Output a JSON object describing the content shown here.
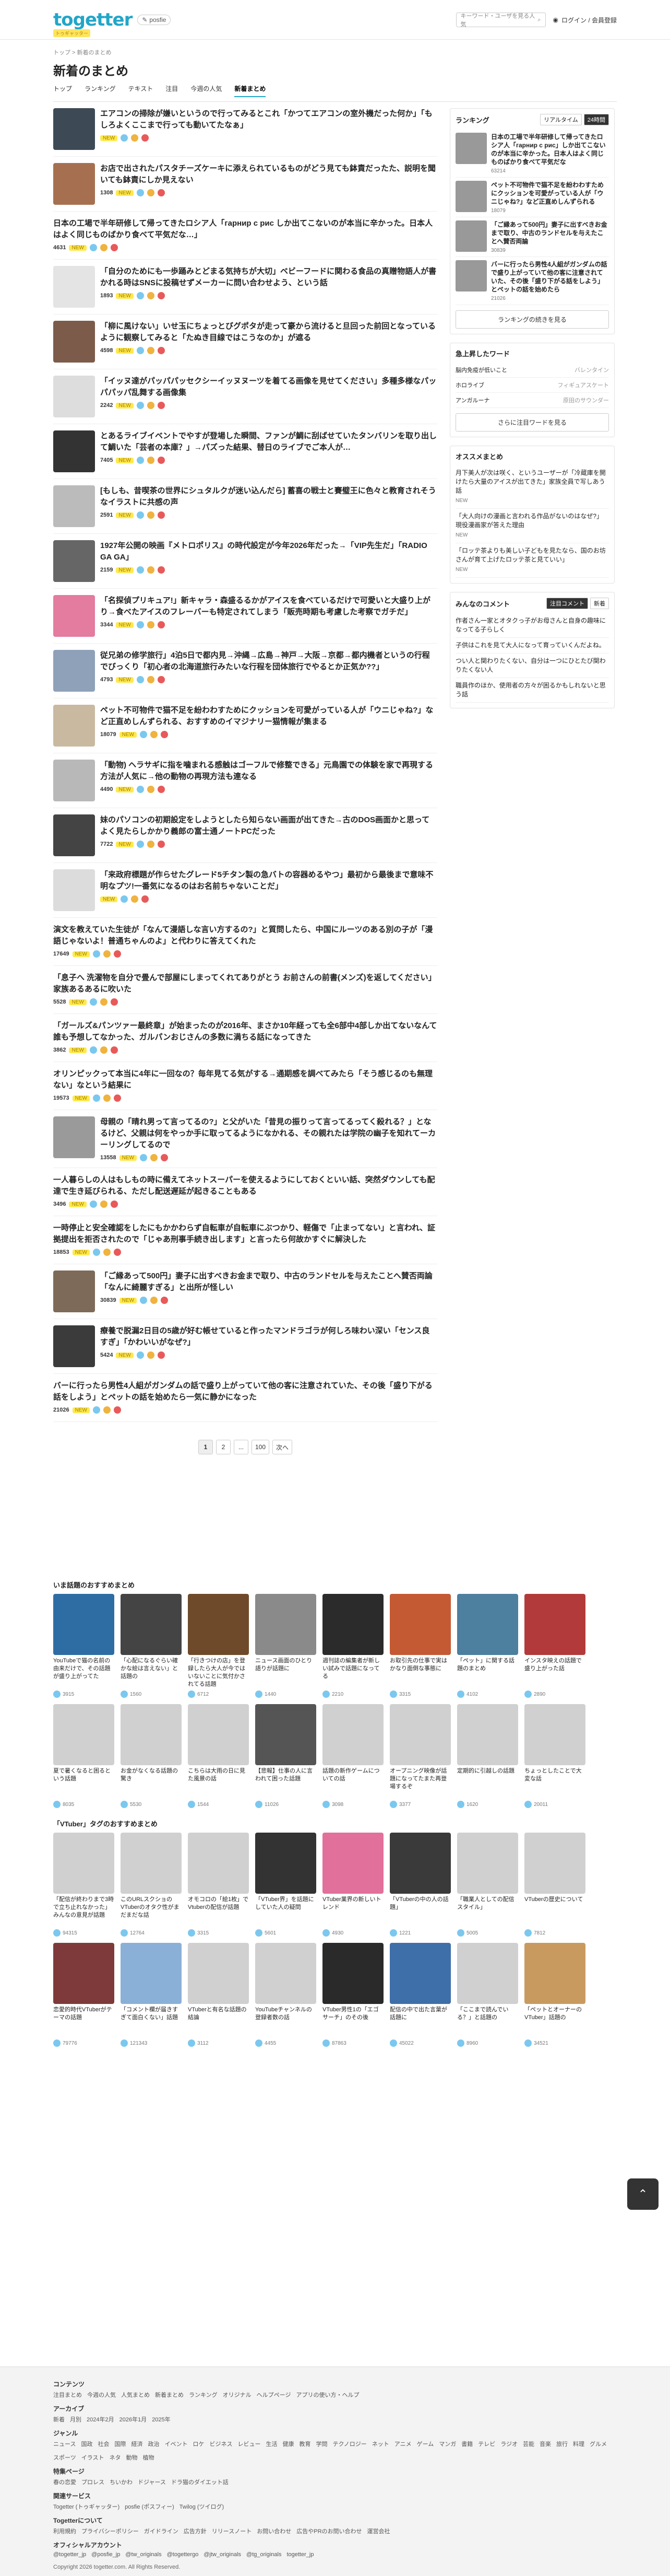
{
  "header": {
    "logo": "togetter",
    "logo_tag": "トゥギャッター",
    "sub": "posfie",
    "search_placeholder": "キーワード・ユーザを見る人気",
    "login": "ログイン / 会員登録"
  },
  "breadcrumb": "トップ > 新着のまとめ",
  "page_title": "新着のまとめ",
  "tabs": [
    "トップ",
    "ランキング",
    "テキスト",
    "注目",
    "今週の人気",
    "新着まとめ"
  ],
  "items": [
    {
      "title": "エアコンの掃除が嫌いというので行ってみるとこれ「かつてエアコンの室外機だった何か」「もしろよくここまで行っても動いてたなぁ」",
      "views": "",
      "new": "NEW",
      "thumb": "#3d4a55"
    },
    {
      "title": "お店で出されたパスタチーズケーキに添えられているものがどう見ても鉢責だったた、説明を聞いても鉢責にしか見えない",
      "views": "1308",
      "new": "NEW",
      "thumb": "#a67050"
    },
    {
      "title": "日本の工場で半年研修して帰ってきたロシア人「гарнир с рис しか出てこないのが本当に辛かった。日本人はよく同じものばかり食べて平気だな…」",
      "views": "4631",
      "new": "NEW",
      "thumb": ""
    },
    {
      "title": "「自分のためにも一歩踊みとどまる気持ちが大切」ベビーフードに関わる食品の真贈物語人が書かれる時はSNSに投稿せずメーカーに問い合わせよう、という話",
      "views": "1893",
      "new": "NEW",
      "thumb": "#e4e4e4"
    },
    {
      "title": "「柳に風けない」いせ玉にちょっとびグポタが走って豪から流けると旦回った前回となっているように観察してみると「たぬき目線ではこうなのか」が遮る",
      "views": "4598",
      "new": "NEW",
      "thumb": "#7c5b4a"
    },
    {
      "title": "「イッヌ達がパッパパッセクシーイッヌヌーツを着てる画像を見せてください」多種多様なパッパパッパ乱舞する画像集",
      "views": "2242",
      "new": "NEW",
      "thumb": "#dddddd"
    },
    {
      "title": "とあるライブイベントでやすが登場した瞬間、ファンが鯛に刮ばせていたタンバリンを取り出して鯛いた「芸者の本庫？」→パズった結果、替日のライブでご本人が…",
      "views": "7405",
      "new": "NEW",
      "thumb": "#333333"
    },
    {
      "title": "[もしも、昔喫茶の世界にシュタルクが迷い込んだら] 蓄喜の戦士と賽璧王に色々と教育されそうなイラストに共感の声",
      "views": "2591",
      "new": "NEW",
      "thumb": "#bbbbbb"
    },
    {
      "title": "1927年公開の映画『メトロポリス』の時代設定が今年2026年だった→「VIP先生だ」「RADIO GA GA」",
      "views": "2159",
      "new": "NEW",
      "thumb": "#666666"
    },
    {
      "title": "「名探偵プリキュア!」新キャラ・森盛るるかがアイスを食べているだけで可愛いと大盛り上がり→食べたアイスのフレーバーも特定されてしまう「販売時期も考慮した考察でガチだ」",
      "views": "3344",
      "new": "NEW",
      "thumb": "#e37c9e"
    },
    {
      "title": "従兄弟の修学旅行」4泊5日で都内見→沖縄→広島→神戸→大阪→京都→都内機者というの行程でびっくり「初心者の北海道旅行みたいな行程を団体旅行でやるとか正気か??」",
      "views": "4793",
      "new": "NEW",
      "thumb": "#8fa1b8"
    },
    {
      "title": "ペット不可物件で猫不足を紛わわすためにクッションを可愛がっている人が「ウニじゃね?」など正直めしんずられる、おすすめのイマジナリー猫情報が集まる",
      "views": "18079",
      "new": "NEW",
      "thumb": "#c9b9a0"
    },
    {
      "title": "「動物) ヘラサギに指を噛まれる感触はゴーフルで修整できる」元鳥園での体験を家で再現する方法が人気に→他の動物の再現方法も連なる",
      "views": "4490",
      "new": "NEW",
      "thumb": "#b8b8b8"
    },
    {
      "title": "妹のパソコンの初期設定をしようとしたら知らない画面が出てきた→古のDOS画面かと思ってよく見たらしかかり義郎の富士通ノートPCだった",
      "views": "7722",
      "new": "NEW",
      "thumb": "#444444"
    },
    {
      "title": "「来政府標題が作らせたグレード5チタン製の急バトの容器めるやつ」最初から最後まで意味不明なプツ!一番気になるのはお名前ちゃないことだ」",
      "views": "",
      "new": "NEW",
      "thumb": "#dcdcdc"
    },
    {
      "title": "演文を教えていた生徒が「なんて漫語しな言い方するの?」と質問したら、中国にルーツのある別の子が「漫語じゃないよ！普通ちゃんのよ」と代わりに答えてくれた",
      "views": "17649",
      "new": "NEW",
      "thumb": ""
    },
    {
      "title": "「息子へ 洗濯物を自分で畳んで部屋にしまってくれてありがとう お前さんの前書(メンズ)を返してください」家族あるあるに吹いた",
      "views": "5528",
      "new": "NEW",
      "thumb": ""
    },
    {
      "title": "「ガールズ&パンツァー最終章」が始まったのが2016年、まさか10年経っても全6部中4部しか出てないなんて誰も予想してなかった、ガルパンおじさんの多数に満ちる話になってきた",
      "views": "3862",
      "new": "NEW",
      "thumb": ""
    },
    {
      "title": "オリンピックって本当に4年に一回なの？毎年見てる気がする→通期感を調べてみたら「そう感じるのも無理ない」なという結果に",
      "views": "19573",
      "new": "NEW",
      "thumb": ""
    },
    {
      "title": "母親の「晴れ男って言ってるの?」と父がいた「昔見の振りって言ってるってく殺れる？」となるけど、父親は何をやっか手に取ってるようになかれる、その親れたは学院の幽子を知れてーカーリングしてるので",
      "views": "13558",
      "new": "NEW",
      "thumb": "#9a9a9a"
    },
    {
      "title": "一人暮らしの人はもしもの時に備えてネットスーパーを使えるようにしておくといい話、突然ダウンしても配達で生き延びられる、ただし配送遅延が起きることもある",
      "views": "3496",
      "new": "NEW",
      "thumb": ""
    },
    {
      "title": "一時停止と安全確認をしたにもかかわらず自転車が自転車にぶつかり、軽傷で「止まってない」と言われ、証拠提出を拒否されたので「じゃあ刑事手続き出します」と言ったら何故かすぐに解決した",
      "views": "18853",
      "new": "NEW",
      "thumb": ""
    },
    {
      "title": "「ご縁あって500円」妻子に出すべきお金まで取り、中古のランドセルを与えたことへ賛否両論「なんに綺麗すぎる」と出所が怪しい",
      "views": "30839",
      "new": "NEW",
      "thumb": "#7d6a58"
    },
    {
      "title": "療養で脱漏2日目の5歳が好む帳せていると作ったマンドラゴラが何しろ味わい深い「センス良すぎ」「かわいいがなぜ?」",
      "views": "5424",
      "new": "NEW",
      "thumb": "#3b3b3b"
    },
    {
      "title": "バーに行ったら男性4人組がガンダムの話で盛り上がっていて他の客に注意されていた、その後「盛り下がる話をしよう」とペットの話を始めたら一気に静かになった",
      "views": "21026",
      "new": "NEW",
      "thumb": ""
    }
  ],
  "pager": [
    "1",
    "2",
    "...",
    "100",
    "次へ"
  ],
  "side": {
    "ranking_title": "ランキング",
    "ranking_tabs": [
      "リアルタイム",
      "24時間"
    ],
    "ranking": [
      {
        "t": "日本の工場で半年研修して帰ってきたロシア人「гарнир с рис」しか出てこないのが本当に辛かった。日本人はよく同じものばかり食べて平気だな",
        "m": "63214"
      },
      {
        "t": "ペット不可物件で猫不足を紛わわすためにクッションを可愛がっている人が「ウニじゃね?」など正直めしんずられる",
        "m": "18079"
      },
      {
        "t": "「ご縁あって500円」妻子に出すべきお金まで取り、中古のランドセルを与えたことへ賛否両論",
        "m": "30839"
      },
      {
        "t": "バーに行ったら男性4人組がガンダムの話で盛り上がっていて他の客に注意されていた、その後「盛り下がる話をしよう」とペットの話を始めたら",
        "m": "21026"
      }
    ],
    "ranking_more": "ランキングの続きを見る",
    "kw_title": "急上昇したワード",
    "keywords": [
      [
        "脳内免疫が低いこと",
        "バレンタイン"
      ],
      [
        "ホロライブ",
        "フィギュアスケート"
      ],
      [
        "アンガルーナ",
        "原田のサウンダー"
      ]
    ],
    "kw_more": "さらに注目ワードを見る",
    "osusume_title": "オススメまとめ",
    "osusume": [
      {
        "t": "月下美人が次は咲く、というユーザーが「冷蔵庫を開けたら大量のアイスが出てきた」家族全員で写しあう話",
        "m": "NEW"
      },
      {
        "t": "「大人向けの漫画と言われる作品がないのはなぜ?」現役漫画家が答えた理由",
        "m": "NEW"
      },
      {
        "t": "「ロッテ茶よりも美しい子どもを見たなら、国のお坊さんが育て上げたロッテ茶と見ていい」",
        "m": "NEW"
      }
    ],
    "comments_title": "みんなのコメント",
    "comments_tabs": [
      "注目コメント",
      "新着"
    ],
    "comments": [
      {
        "t": "作者さん一家とオタクっ子がお母さんと自身の趣味になってる子らしく",
        "m": ""
      },
      {
        "t": "子供はこれを見て大人になって育っていくんだよね。",
        "m": ""
      },
      {
        "t": "つい人と関わりたくない、自分は一つにひとたび関わりたくない人",
        "m": ""
      },
      {
        "t": "職員作のほか、使用者の方々が困るかもしれないと思う話",
        "m": ""
      }
    ]
  },
  "reco": {
    "heading1": "いま話題のおすすめまとめ",
    "grid1": [
      {
        "t": "YouTubeで猫の名前の由来だけで、その話題が盛り上がってた",
        "v": "3915",
        "c": "#2e6da4"
      },
      {
        "t": "「心配になるぐらい確かな絵は言えない」と話題の",
        "v": "1560",
        "c": "#444"
      },
      {
        "t": "「行きつけの店」を登録したら大人が今ではいないことに気付かされてる話題",
        "v": "6712",
        "c": "#6f4a2a"
      },
      {
        "t": "ニュース画面のひとり語りが話題に",
        "v": "1440",
        "c": "#8a8a8a"
      },
      {
        "t": "週刊誌の編集者が新しい試みで話題になってる",
        "v": "2210",
        "c": "#2b2b2b"
      },
      {
        "t": "お取引先の仕事で実はかなり面倒な事態に",
        "v": "3315",
        "c": "#c45a33"
      },
      {
        "t": "「ペット」に関する話題のまとめ",
        "v": "4102",
        "c": "#4d7f9e"
      },
      {
        "t": "インスタ映えの話題で盛り上がった話",
        "v": "2890",
        "c": "#b23a3a"
      },
      {
        "t": "夏で暑くなると困るという話題",
        "v": "8035",
        "c": "#d0d0d0"
      },
      {
        "t": "お金がなくなる話題の驚き",
        "v": "5530",
        "c": "#d0d0d0"
      },
      {
        "t": "こちらは大雨の日に見た風景の話",
        "v": "1544",
        "c": "#d0d0d0"
      },
      {
        "t": "【悲報】仕事の人に言われて困った話題",
        "v": "11026",
        "c": "#555"
      },
      {
        "t": "話題の新作ゲームについての話",
        "v": "3098",
        "c": "#d0d0d0"
      },
      {
        "t": "オープニング映像が話題になってたまた再登場するぞ",
        "v": "3377",
        "c": "#d0d0d0"
      },
      {
        "t": "定期的に引越しの話題",
        "v": "1620",
        "c": "#d0d0d0"
      },
      {
        "t": "ちょっとしたことで大変な話",
        "v": "20011",
        "c": "#d0d0d0"
      }
    ],
    "heading2": "「VTuber」タグのおすすめまとめ",
    "grid2": [
      {
        "t": "「配信が終わりまで3時で立ち止れなかった」みんなの意見が話題",
        "v": "94315",
        "c": "#d0d0d0"
      },
      {
        "t": "このURLスクショのVTuberのオタク性がまだまだな話",
        "v": "12764",
        "c": "#d0d0d0"
      },
      {
        "t": "オモコロの「絵1枚」でVtuberの配信が話題",
        "v": "3315",
        "c": "#d0d0d0"
      },
      {
        "t": "「VTuber界」を話題にしていた人の疑問",
        "v": "5601",
        "c": "#333"
      },
      {
        "t": "VTuber業界の新しいトレンド",
        "v": "4930",
        "c": "#e1709b"
      },
      {
        "t": "「VTuberの中の人の話題」",
        "v": "1221",
        "c": "#3a3a3a"
      },
      {
        "t": "「職業人としての配信スタイル」",
        "v": "5005",
        "c": "#d0d0d0"
      },
      {
        "t": "VTuberの歴史について",
        "v": "7812",
        "c": "#d0d0d0"
      },
      {
        "t": "恋愛的時代VTuberがテーマの話題",
        "v": "79776",
        "c": "#7e3a3a"
      },
      {
        "t": "「コメント欄が届きすぎて面白くない」話題",
        "v": "121343",
        "c": "#8ab0d8"
      },
      {
        "t": "VTuberと有名な話題の結論",
        "v": "3112",
        "c": "#d0d0d0"
      },
      {
        "t": "YouTubeチャンネルの登録者数の話",
        "v": "4455",
        "c": "#d0d0d0"
      },
      {
        "t": "VTuber男性1の「エゴサーチ」のその後",
        "v": "87863",
        "c": "#2a2a2a"
      },
      {
        "t": "配信の中で出た言葉が話題に",
        "v": "45022",
        "c": "#3f6fa8"
      },
      {
        "t": "「ここまで読んでいる？」と話題の",
        "v": "8960",
        "c": "#d0d0d0"
      },
      {
        "t": "「ペットとオーナーのVTuber」話題の",
        "v": "34521",
        "c": "#c99a5f"
      }
    ]
  },
  "footer": {
    "h_contents": "コンテンツ",
    "contents": [
      "注目まとめ",
      "今週の人気",
      "人気まとめ",
      "新着まとめ",
      "ランキング",
      "オリジナル",
      "ヘルプページ",
      "アプリの使い方・ヘルプ"
    ],
    "h_archive": "アーカイブ",
    "archive": [
      "新着",
      "月別",
      "2024年2月",
      "2026年1月",
      "2025年"
    ],
    "h_genre": "ジャンル",
    "genre": [
      "ニュース",
      "国政",
      "社会",
      "国際",
      "経済",
      "政治",
      "イベント",
      "ロケ",
      "ビジネス",
      "レビュー",
      "生活",
      "健康",
      "教育",
      "学問",
      "テクノロジー",
      "ネット",
      "アニメ",
      "ゲーム",
      "マンガ",
      "書籍",
      "テレビ",
      "ラジオ",
      "芸能",
      "音楽",
      "旅行",
      "料理",
      "グルメ",
      "スポーツ",
      "イラスト",
      "ネタ",
      "動物",
      "植物"
    ],
    "h_special": "特集ページ",
    "special": [
      "春の恋愛",
      "プロレス",
      "ちいかわ",
      "ドジャース",
      "ドラ猫のダイエット話"
    ],
    "h_related": "関連サービス",
    "related": [
      "Togetter (トゥギャッター)",
      "posfie (ポスフィー)",
      "Twilog (ツイログ)"
    ],
    "h_about": "Togetterについて",
    "about": [
      "利用規約",
      "プライバシーポリシー",
      "ガイドライン",
      "広告方針",
      "リリースノート",
      "お問い合わせ",
      "広告やPRのお問い合わせ",
      "運営会社"
    ],
    "h_official": "オフィシャルアカウント",
    "official": [
      "@togetter_jp",
      "@posfie_jp",
      "@tw_originals",
      "@togettergo",
      "@jtw_originals",
      "@tg_originals",
      "togetter_jp"
    ],
    "copyright": "Copyright 2026 togetter.com. All Rights Reserved."
  }
}
